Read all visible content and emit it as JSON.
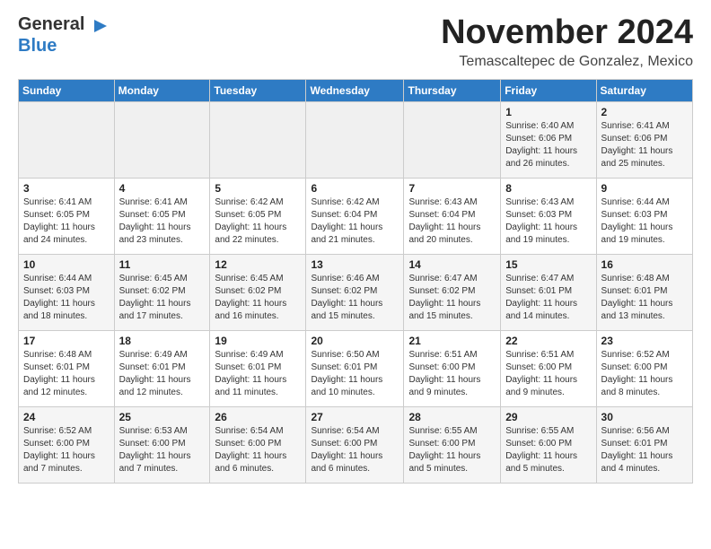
{
  "logo": {
    "general": "General",
    "blue": "Blue",
    "arrow_unicode": "▶"
  },
  "header": {
    "month_title": "November 2024",
    "location": "Temascaltepec de Gonzalez, Mexico"
  },
  "weekdays": [
    "Sunday",
    "Monday",
    "Tuesday",
    "Wednesday",
    "Thursday",
    "Friday",
    "Saturday"
  ],
  "weeks": [
    [
      {
        "day": "",
        "info": ""
      },
      {
        "day": "",
        "info": ""
      },
      {
        "day": "",
        "info": ""
      },
      {
        "day": "",
        "info": ""
      },
      {
        "day": "",
        "info": ""
      },
      {
        "day": "1",
        "info": "Sunrise: 6:40 AM\nSunset: 6:06 PM\nDaylight: 11 hours and 26 minutes."
      },
      {
        "day": "2",
        "info": "Sunrise: 6:41 AM\nSunset: 6:06 PM\nDaylight: 11 hours and 25 minutes."
      }
    ],
    [
      {
        "day": "3",
        "info": "Sunrise: 6:41 AM\nSunset: 6:05 PM\nDaylight: 11 hours and 24 minutes."
      },
      {
        "day": "4",
        "info": "Sunrise: 6:41 AM\nSunset: 6:05 PM\nDaylight: 11 hours and 23 minutes."
      },
      {
        "day": "5",
        "info": "Sunrise: 6:42 AM\nSunset: 6:05 PM\nDaylight: 11 hours and 22 minutes."
      },
      {
        "day": "6",
        "info": "Sunrise: 6:42 AM\nSunset: 6:04 PM\nDaylight: 11 hours and 21 minutes."
      },
      {
        "day": "7",
        "info": "Sunrise: 6:43 AM\nSunset: 6:04 PM\nDaylight: 11 hours and 20 minutes."
      },
      {
        "day": "8",
        "info": "Sunrise: 6:43 AM\nSunset: 6:03 PM\nDaylight: 11 hours and 19 minutes."
      },
      {
        "day": "9",
        "info": "Sunrise: 6:44 AM\nSunset: 6:03 PM\nDaylight: 11 hours and 19 minutes."
      }
    ],
    [
      {
        "day": "10",
        "info": "Sunrise: 6:44 AM\nSunset: 6:03 PM\nDaylight: 11 hours and 18 minutes."
      },
      {
        "day": "11",
        "info": "Sunrise: 6:45 AM\nSunset: 6:02 PM\nDaylight: 11 hours and 17 minutes."
      },
      {
        "day": "12",
        "info": "Sunrise: 6:45 AM\nSunset: 6:02 PM\nDaylight: 11 hours and 16 minutes."
      },
      {
        "day": "13",
        "info": "Sunrise: 6:46 AM\nSunset: 6:02 PM\nDaylight: 11 hours and 15 minutes."
      },
      {
        "day": "14",
        "info": "Sunrise: 6:47 AM\nSunset: 6:02 PM\nDaylight: 11 hours and 15 minutes."
      },
      {
        "day": "15",
        "info": "Sunrise: 6:47 AM\nSunset: 6:01 PM\nDaylight: 11 hours and 14 minutes."
      },
      {
        "day": "16",
        "info": "Sunrise: 6:48 AM\nSunset: 6:01 PM\nDaylight: 11 hours and 13 minutes."
      }
    ],
    [
      {
        "day": "17",
        "info": "Sunrise: 6:48 AM\nSunset: 6:01 PM\nDaylight: 11 hours and 12 minutes."
      },
      {
        "day": "18",
        "info": "Sunrise: 6:49 AM\nSunset: 6:01 PM\nDaylight: 11 hours and 12 minutes."
      },
      {
        "day": "19",
        "info": "Sunrise: 6:49 AM\nSunset: 6:01 PM\nDaylight: 11 hours and 11 minutes."
      },
      {
        "day": "20",
        "info": "Sunrise: 6:50 AM\nSunset: 6:01 PM\nDaylight: 11 hours and 10 minutes."
      },
      {
        "day": "21",
        "info": "Sunrise: 6:51 AM\nSunset: 6:00 PM\nDaylight: 11 hours and 9 minutes."
      },
      {
        "day": "22",
        "info": "Sunrise: 6:51 AM\nSunset: 6:00 PM\nDaylight: 11 hours and 9 minutes."
      },
      {
        "day": "23",
        "info": "Sunrise: 6:52 AM\nSunset: 6:00 PM\nDaylight: 11 hours and 8 minutes."
      }
    ],
    [
      {
        "day": "24",
        "info": "Sunrise: 6:52 AM\nSunset: 6:00 PM\nDaylight: 11 hours and 7 minutes."
      },
      {
        "day": "25",
        "info": "Sunrise: 6:53 AM\nSunset: 6:00 PM\nDaylight: 11 hours and 7 minutes."
      },
      {
        "day": "26",
        "info": "Sunrise: 6:54 AM\nSunset: 6:00 PM\nDaylight: 11 hours and 6 minutes."
      },
      {
        "day": "27",
        "info": "Sunrise: 6:54 AM\nSunset: 6:00 PM\nDaylight: 11 hours and 6 minutes."
      },
      {
        "day": "28",
        "info": "Sunrise: 6:55 AM\nSunset: 6:00 PM\nDaylight: 11 hours and 5 minutes."
      },
      {
        "day": "29",
        "info": "Sunrise: 6:55 AM\nSunset: 6:00 PM\nDaylight: 11 hours and 5 minutes."
      },
      {
        "day": "30",
        "info": "Sunrise: 6:56 AM\nSunset: 6:01 PM\nDaylight: 11 hours and 4 minutes."
      }
    ]
  ]
}
